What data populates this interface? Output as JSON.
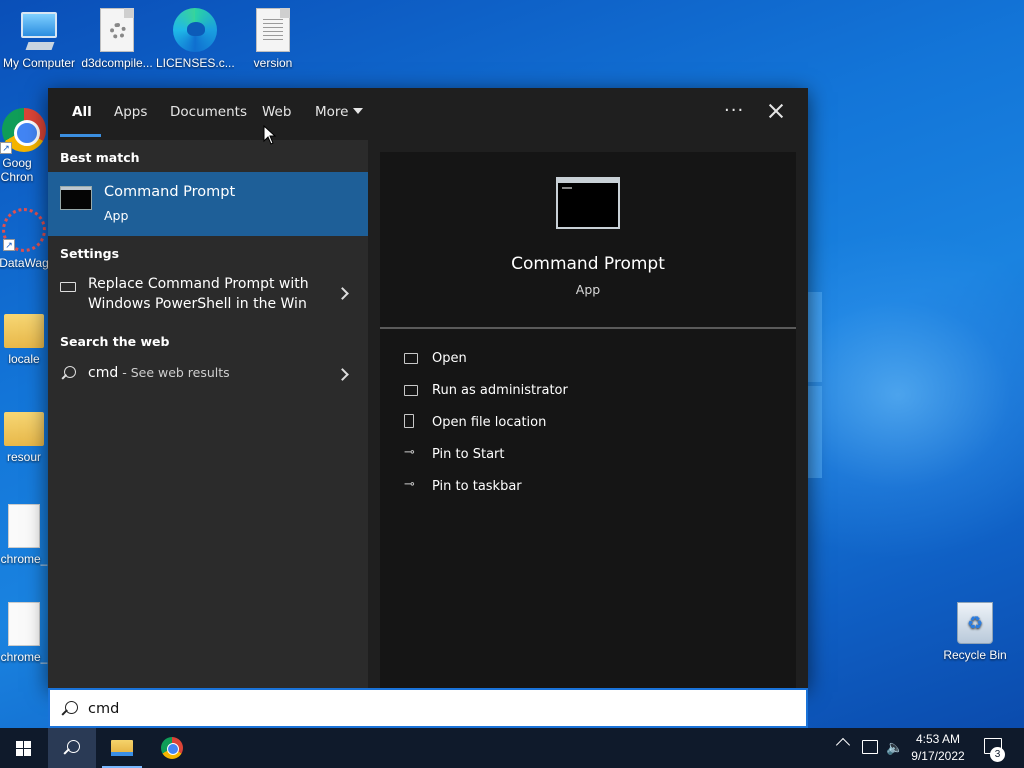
{
  "desktop": {
    "icons_top": [
      {
        "label": "My Computer"
      },
      {
        "label": "d3dcompile..."
      },
      {
        "label": "LICENSES.c..."
      },
      {
        "label": "version"
      }
    ],
    "icons_left": [
      {
        "label": "Goog Chron"
      },
      {
        "label": "DataWag"
      },
      {
        "label": "locale"
      },
      {
        "label": "resour"
      },
      {
        "label": "chrome_"
      },
      {
        "label": "chrome_"
      }
    ],
    "recycle_bin": "Recycle Bin"
  },
  "search": {
    "tabs": [
      {
        "label": "All",
        "active": true
      },
      {
        "label": "Apps"
      },
      {
        "label": "Documents"
      },
      {
        "label": "Web"
      },
      {
        "label": "More"
      }
    ],
    "more_options": "···",
    "sections": {
      "best_match": "Best match",
      "settings": "Settings",
      "search_web": "Search the web"
    },
    "best_match": {
      "title": "Command Prompt",
      "subtitle": "App",
      "icon": "command-prompt-icon"
    },
    "settings_item": {
      "text": "Replace Command Prompt with Windows PowerShell in the Win"
    },
    "web_item": {
      "query": "cmd",
      "suffix": " - See web results"
    },
    "preview": {
      "title": "Command Prompt",
      "subtitle": "App",
      "actions": [
        {
          "label": "Open",
          "icon": "open-icon"
        },
        {
          "label": "Run as administrator",
          "icon": "shield-icon"
        },
        {
          "label": "Open file location",
          "icon": "file-location-icon"
        },
        {
          "label": "Pin to Start",
          "icon": "pin-icon"
        },
        {
          "label": "Pin to taskbar",
          "icon": "pin-icon"
        }
      ]
    },
    "query": "cmd"
  },
  "taskbar": {
    "time": "4:53 AM",
    "date": "9/17/2022",
    "notification_count": "3"
  },
  "colors": {
    "accent": "#1e5f98",
    "tab_underline": "#3b8fe0",
    "panel_bg": "#1f1f1f"
  }
}
